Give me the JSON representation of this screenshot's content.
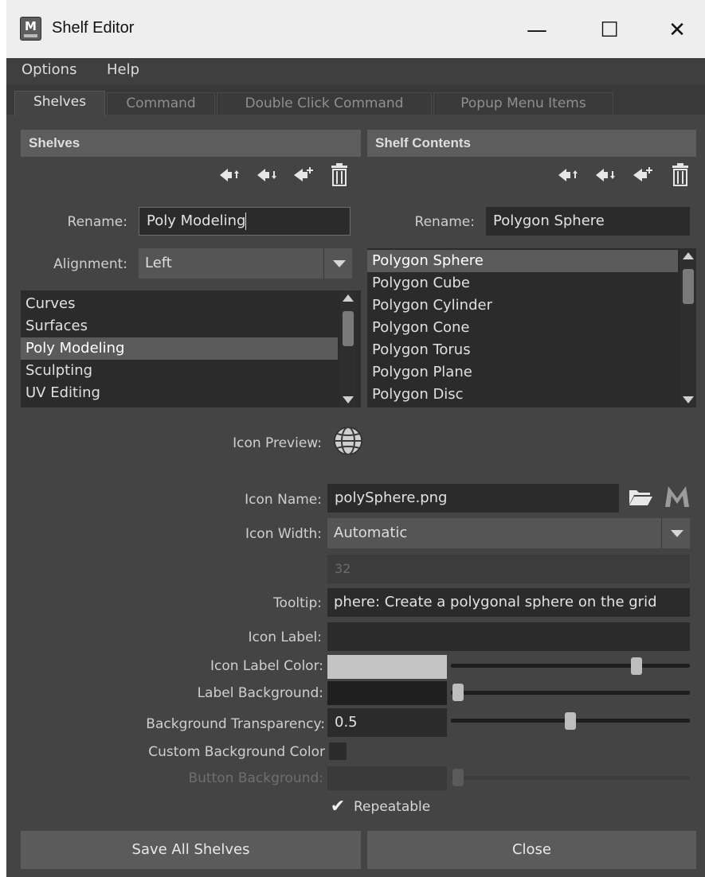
{
  "window": {
    "title": "Shelf Editor",
    "app_icon_letter": "M",
    "minimize_glyph": "—",
    "maximize_glyph": "☐",
    "close_glyph": "✕"
  },
  "menubar": {
    "items": [
      "Options",
      "Help"
    ]
  },
  "tabs": [
    {
      "label": "Shelves",
      "active": true
    },
    {
      "label": "Command",
      "active": false
    },
    {
      "label": "Double Click Command",
      "active": false
    },
    {
      "label": "Popup Menu Items",
      "active": false
    }
  ],
  "shelves_panel": {
    "header": "Shelves",
    "rename_label": "Rename:",
    "rename_value": "Poly Modeling",
    "alignment_label": "Alignment:",
    "alignment_value": "Left",
    "items": [
      "Curves",
      "Surfaces",
      "Poly Modeling",
      "Sculpting",
      "UV Editing"
    ],
    "selected_index": 2
  },
  "contents_panel": {
    "header": "Shelf Contents",
    "rename_label": "Rename:",
    "rename_value": "Polygon Sphere",
    "items": [
      "Polygon Sphere",
      "Polygon Cube",
      "Polygon Cylinder",
      "Polygon Cone",
      "Polygon Torus",
      "Polygon Plane",
      "Polygon Disc"
    ],
    "selected_index": 0
  },
  "properties": {
    "icon_preview_label": "Icon Preview:",
    "icon_name_label": "Icon Name:",
    "icon_name_value": "polySphere.png",
    "icon_width_label": "Icon Width:",
    "icon_width_value": "Automatic",
    "icon_width_number": "32",
    "tooltip_label": "Tooltip:",
    "tooltip_value": "phere: Create a polygonal sphere on the grid",
    "icon_label_label": "Icon Label:",
    "icon_label_value": "",
    "icon_label_color_label": "Icon Label Color:",
    "icon_label_color": "#c4c4c4",
    "icon_label_color_slider": 0.79,
    "label_background_label": "Label Background:",
    "label_background_color": "#1f1f1f",
    "label_background_slider": 0.0,
    "bg_transparency_label": "Background Transparency:",
    "bg_transparency_value": "0.5",
    "bg_transparency_slider": 0.5,
    "custom_bg_label": "Custom Background Color",
    "custom_bg_checked": false,
    "button_bg_label": "Button Background:",
    "button_bg_slider": 0.0,
    "repeatable_label": "Repeatable",
    "repeatable_checked": true,
    "checkmark": "✔"
  },
  "buttons": {
    "save_all": "Save All Shelves",
    "close": "Close"
  },
  "colors": {
    "window_bg": "#444444",
    "field_bg": "#2b2b2b",
    "header_bg": "#5d5d5d",
    "selection_bg": "#5b5b5b",
    "button_bg": "#5b5b5b"
  }
}
